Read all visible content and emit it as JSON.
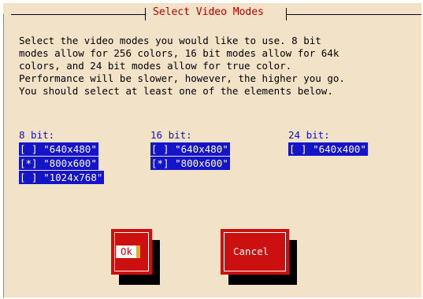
{
  "dialog": {
    "title": "Select Video Modes",
    "description_lines": [
      "Select the video modes you would like to use.  8 bit",
      "modes allow for 256 colors, 16 bit modes allow for 64k",
      "colors, and 24 bit modes allow for true color.",
      "Performance will be slower, however, the higher you go.",
      "You should select at least one of the elements below."
    ]
  },
  "groups": [
    {
      "heading": "8 bit:",
      "modes": [
        {
          "check": "[ ]",
          "label": "\"640x480\"",
          "selected": false
        },
        {
          "check": "[*]",
          "label": "\"800x600\"",
          "selected": true
        },
        {
          "check": "[ ]",
          "label": "\"1024x768\"",
          "selected": false
        }
      ]
    },
    {
      "heading": "16 bit:",
      "modes": [
        {
          "check": "[ ]",
          "label": "\"640x480\"",
          "selected": false
        },
        {
          "check": "[*]",
          "label": "\"800x600\"",
          "selected": true
        }
      ]
    },
    {
      "heading": "24 bit:",
      "modes": [
        {
          "check": "[ ]",
          "label": "\"640x400\"",
          "selected": false
        }
      ]
    }
  ],
  "buttons": {
    "ok_label": "Ok",
    "cancel_label": "Cancel"
  },
  "colors": {
    "background": "#f2e2c8",
    "title": "#c00000",
    "heading": "#1010c0",
    "item_bg": "#1414c8",
    "button_bg": "#cc1010"
  }
}
